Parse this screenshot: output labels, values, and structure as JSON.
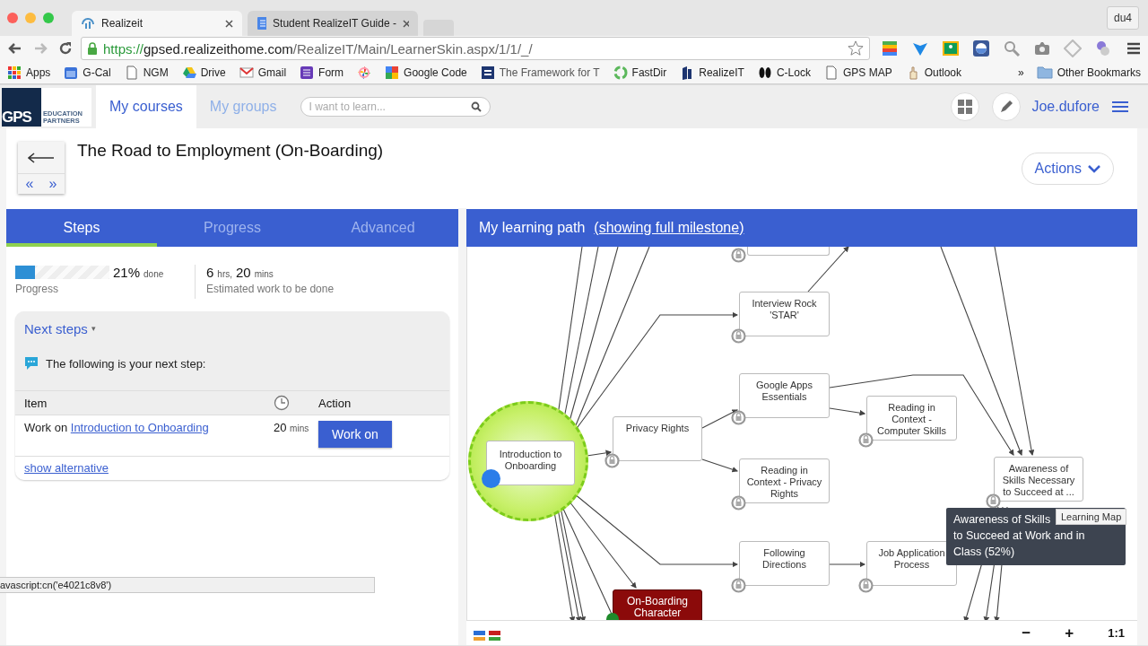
{
  "browser": {
    "tabs": [
      {
        "title": "Realizeit",
        "selected": true
      },
      {
        "title": "Student RealizeIT Guide -",
        "selected": false
      }
    ],
    "profile": "du4",
    "url": {
      "scheme": "https://",
      "host": "gpsed.realizeithome.com",
      "path": "/RealizeIT/Main/LearnerSkin.aspx/1/1/_/"
    },
    "bookmarks": [
      {
        "label": "Apps",
        "kind": "apps"
      },
      {
        "label": "G-Cal",
        "kind": "calendar"
      },
      {
        "label": "NGM",
        "kind": "page"
      },
      {
        "label": "Drive",
        "kind": "drive"
      },
      {
        "label": "Gmail",
        "kind": "mail"
      },
      {
        "label": "Form",
        "kind": "form"
      },
      {
        "kind": "pinwheel"
      },
      {
        "label": "Google Code",
        "kind": "code"
      },
      {
        "label": "The Framework for T",
        "kind": "dg"
      },
      {
        "label": "FastDir",
        "kind": "recycle"
      },
      {
        "label": "RealizeIT",
        "kind": "it"
      },
      {
        "label": "C-Lock",
        "kind": "lock"
      },
      {
        "label": "GPS MAP",
        "kind": "page"
      },
      {
        "label": "Outlook",
        "kind": "hand"
      }
    ],
    "more": "»",
    "other_bookmarks": "Other Bookmarks"
  },
  "app": {
    "logo": {
      "mark": "GPS",
      "line1": "EDUCATION",
      "line2": "PARTNERS"
    },
    "nav": [
      {
        "label": "My courses",
        "selected": true
      },
      {
        "label": "My groups",
        "selected": false
      }
    ],
    "search": {
      "placeholder": "I want to learn..."
    },
    "user": "Joe.dufore"
  },
  "course": {
    "title": "The Road to Employment (On-Boarding)",
    "prev": "«",
    "next": "»",
    "actions": "Actions"
  },
  "steps_panel": {
    "tabs": [
      {
        "label": "Steps",
        "selected": true
      },
      {
        "label": "Progress",
        "selected": false
      },
      {
        "label": "Advanced",
        "selected": false
      }
    ],
    "progress": {
      "level": 0.21,
      "percent": "21%",
      "done": "done",
      "label": "Progress"
    },
    "estimate": {
      "hours": "6",
      "hours_unit": "hrs,",
      "minutes": "20",
      "minutes_unit": "mins",
      "label": "Estimated work to be done"
    },
    "next_steps": {
      "title": "Next steps",
      "caret": "▾",
      "message": "The following is your next step:",
      "columns": [
        "Item",
        "Action"
      ],
      "rows": [
        {
          "prefix": "Work on",
          "link": "Introduction to Onboarding",
          "minutes": "20",
          "unit": "mins",
          "button": "Work on"
        }
      ],
      "alternative": "show alternative"
    }
  },
  "path_panel": {
    "title": "My learning path",
    "link": "(showing full milestone)",
    "nodes": [
      {
        "kind": "cut",
        "locked": true
      },
      {
        "kind": "current",
        "label": "Introduction to Onboarding",
        "locked": false
      },
      {
        "kind": "step",
        "label": "Privacy Rights",
        "locked": true
      },
      {
        "kind": "step",
        "label": "Interview Rock 'STAR'",
        "locked": true
      },
      {
        "kind": "step",
        "label": "Google Apps Essentials",
        "locked": true
      },
      {
        "kind": "step",
        "label": "Reading in Context - Privacy Rights",
        "locked": true
      },
      {
        "kind": "step",
        "label": "Following Directions",
        "locked": true
      },
      {
        "kind": "step",
        "label": "Reading in Context - Computer Skills",
        "locked": true
      },
      {
        "kind": "step",
        "label": "Job Application Process",
        "locked": true
      },
      {
        "kind": "step",
        "label": "Awareness of Skills Necessary to Succeed at ...",
        "locked": true
      },
      {
        "kind": "milestone",
        "label": "On-Boarding Character",
        "locked": false
      }
    ],
    "tooltip": {
      "lines": [
        "Awareness of Skills",
        "to Succeed at Work and in",
        "Class (52%)"
      ]
    },
    "hint": "Learning Map",
    "zoom_out": "−",
    "zoom_in": "+",
    "reset": "1:1"
  },
  "status_bar": "avascript:cn('e4021c8v8')"
}
